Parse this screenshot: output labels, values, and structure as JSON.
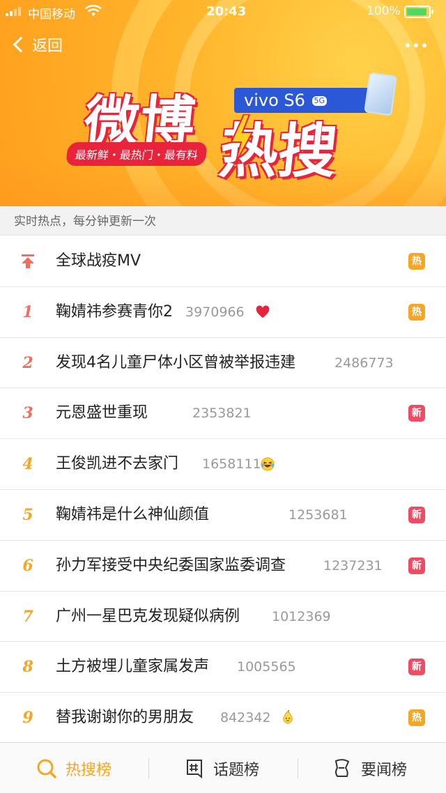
{
  "status_bar": {
    "carrier": "中国移动",
    "time": "20:43",
    "battery": "100%"
  },
  "nav": {
    "back_label": "返回"
  },
  "banner": {
    "logo_text_1": "微博",
    "logo_text_2": "热搜",
    "sponsor": "vivo S6",
    "sponsor_badge": "5G",
    "slogan": "最新鲜・最热门・最有料"
  },
  "subheader": "实时热点，每分钟更新一次",
  "list": [
    {
      "rank": "",
      "title": "全球战疫MV",
      "count": "",
      "emoji": "",
      "badge": "热",
      "badge_type": "hot"
    },
    {
      "rank": "1",
      "title": "鞠婧祎参赛青你2",
      "count": "3970966",
      "emoji": "heart-icon",
      "badge": "热",
      "badge_type": "hot"
    },
    {
      "rank": "2",
      "title": "发现4名儿童尸体小区曾被举报违建",
      "count": "2486773",
      "emoji": "",
      "badge": "",
      "badge_type": ""
    },
    {
      "rank": "3",
      "title": "元恩盛世重现",
      "count": "2353821",
      "emoji": "",
      "badge": "新",
      "badge_type": "new"
    },
    {
      "rank": "4",
      "title": "王俊凯进不去家门",
      "count": "1658111",
      "emoji": "laughing-emoji-icon",
      "badge": "",
      "badge_type": ""
    },
    {
      "rank": "5",
      "title": "鞠婧祎是什么神仙颜值",
      "count": "1253681",
      "emoji": "",
      "badge": "新",
      "badge_type": "new"
    },
    {
      "rank": "6",
      "title": "孙力军接受中央纪委国家监委调查",
      "count": "1237231",
      "emoji": "",
      "badge": "新",
      "badge_type": "new"
    },
    {
      "rank": "7",
      "title": "广州一星巴克发现疑似病例",
      "count": "1012369",
      "emoji": "",
      "badge": "",
      "badge_type": ""
    },
    {
      "rank": "8",
      "title": "土方被埋儿童家属发声",
      "count": "1005565",
      "emoji": "",
      "badge": "新",
      "badge_type": "new"
    },
    {
      "rank": "9",
      "title": "替我谢谢你的男朋友",
      "count": "842342",
      "emoji": "pear-emoji-icon",
      "badge": "热",
      "badge_type": "hot"
    }
  ],
  "tabs": [
    {
      "label": "热搜榜",
      "icon": "search-rank-icon",
      "active": true
    },
    {
      "label": "话题榜",
      "icon": "hashtag-icon",
      "active": false
    },
    {
      "label": "要闻榜",
      "icon": "news-flag-icon",
      "active": false
    }
  ],
  "colors": {
    "accent": "#f5a623",
    "top_rank": "#f26d5f",
    "badge_hot": "#f5a623",
    "badge_new": "#ef4c63",
    "logo_red": "#e8243c",
    "sponsor_blue": "#2b58d6"
  }
}
